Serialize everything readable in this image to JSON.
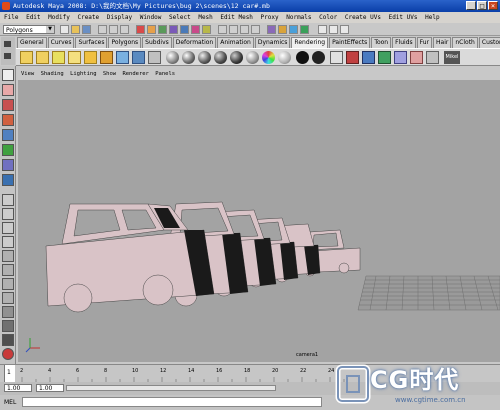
{
  "window": {
    "title": "Autodesk Maya 2008: D:\\我的文档\\My Pictures\\bug 2\\scenes\\12 car#.mb",
    "buttons": [
      "_",
      "□",
      "×"
    ]
  },
  "menubar": {
    "items": [
      "File",
      "Edit",
      "Modify",
      "Create",
      "Display",
      "Window",
      "Select",
      "Mesh",
      "Edit Mesh",
      "Proxy",
      "Normals",
      "Color",
      "Create UVs",
      "Edit UVs",
      "Help"
    ]
  },
  "statusline": {
    "mode_menu": "Polygons"
  },
  "shelf": {
    "tabs": [
      "General",
      "Curves",
      "Surfaces",
      "Polygons",
      "Subdivs",
      "Deformation",
      "Animation",
      "Dynamics",
      "Rendering",
      "PaintEffects",
      "Toon",
      "Fluids",
      "Fur",
      "Hair",
      "nCloth",
      "Custom"
    ],
    "active_tab": "Rendering",
    "right_icon_label": "Mikel"
  },
  "panel": {
    "menus": [
      "View",
      "Shading",
      "Lighting",
      "Show",
      "Renderer",
      "Panels"
    ],
    "camera_label": "camera1"
  },
  "timeline": {
    "current_frame": "1",
    "ticks": [
      "1",
      "2",
      "4",
      "6",
      "8",
      "10",
      "12",
      "14",
      "16",
      "18",
      "20",
      "22",
      "24"
    ]
  },
  "range": {
    "start": "1.00",
    "playback_start": "1.00"
  },
  "command_line": {
    "label": "MEL"
  },
  "watermark": {
    "logo_text": "CG时代",
    "url": "www.cgtime.com.cn"
  },
  "colors": {
    "title_blue": "#0a3fa8",
    "viewport_bg": "#a3a3a3",
    "car_body": "#d9c3c7",
    "car_dark": "#1a1a1a"
  }
}
